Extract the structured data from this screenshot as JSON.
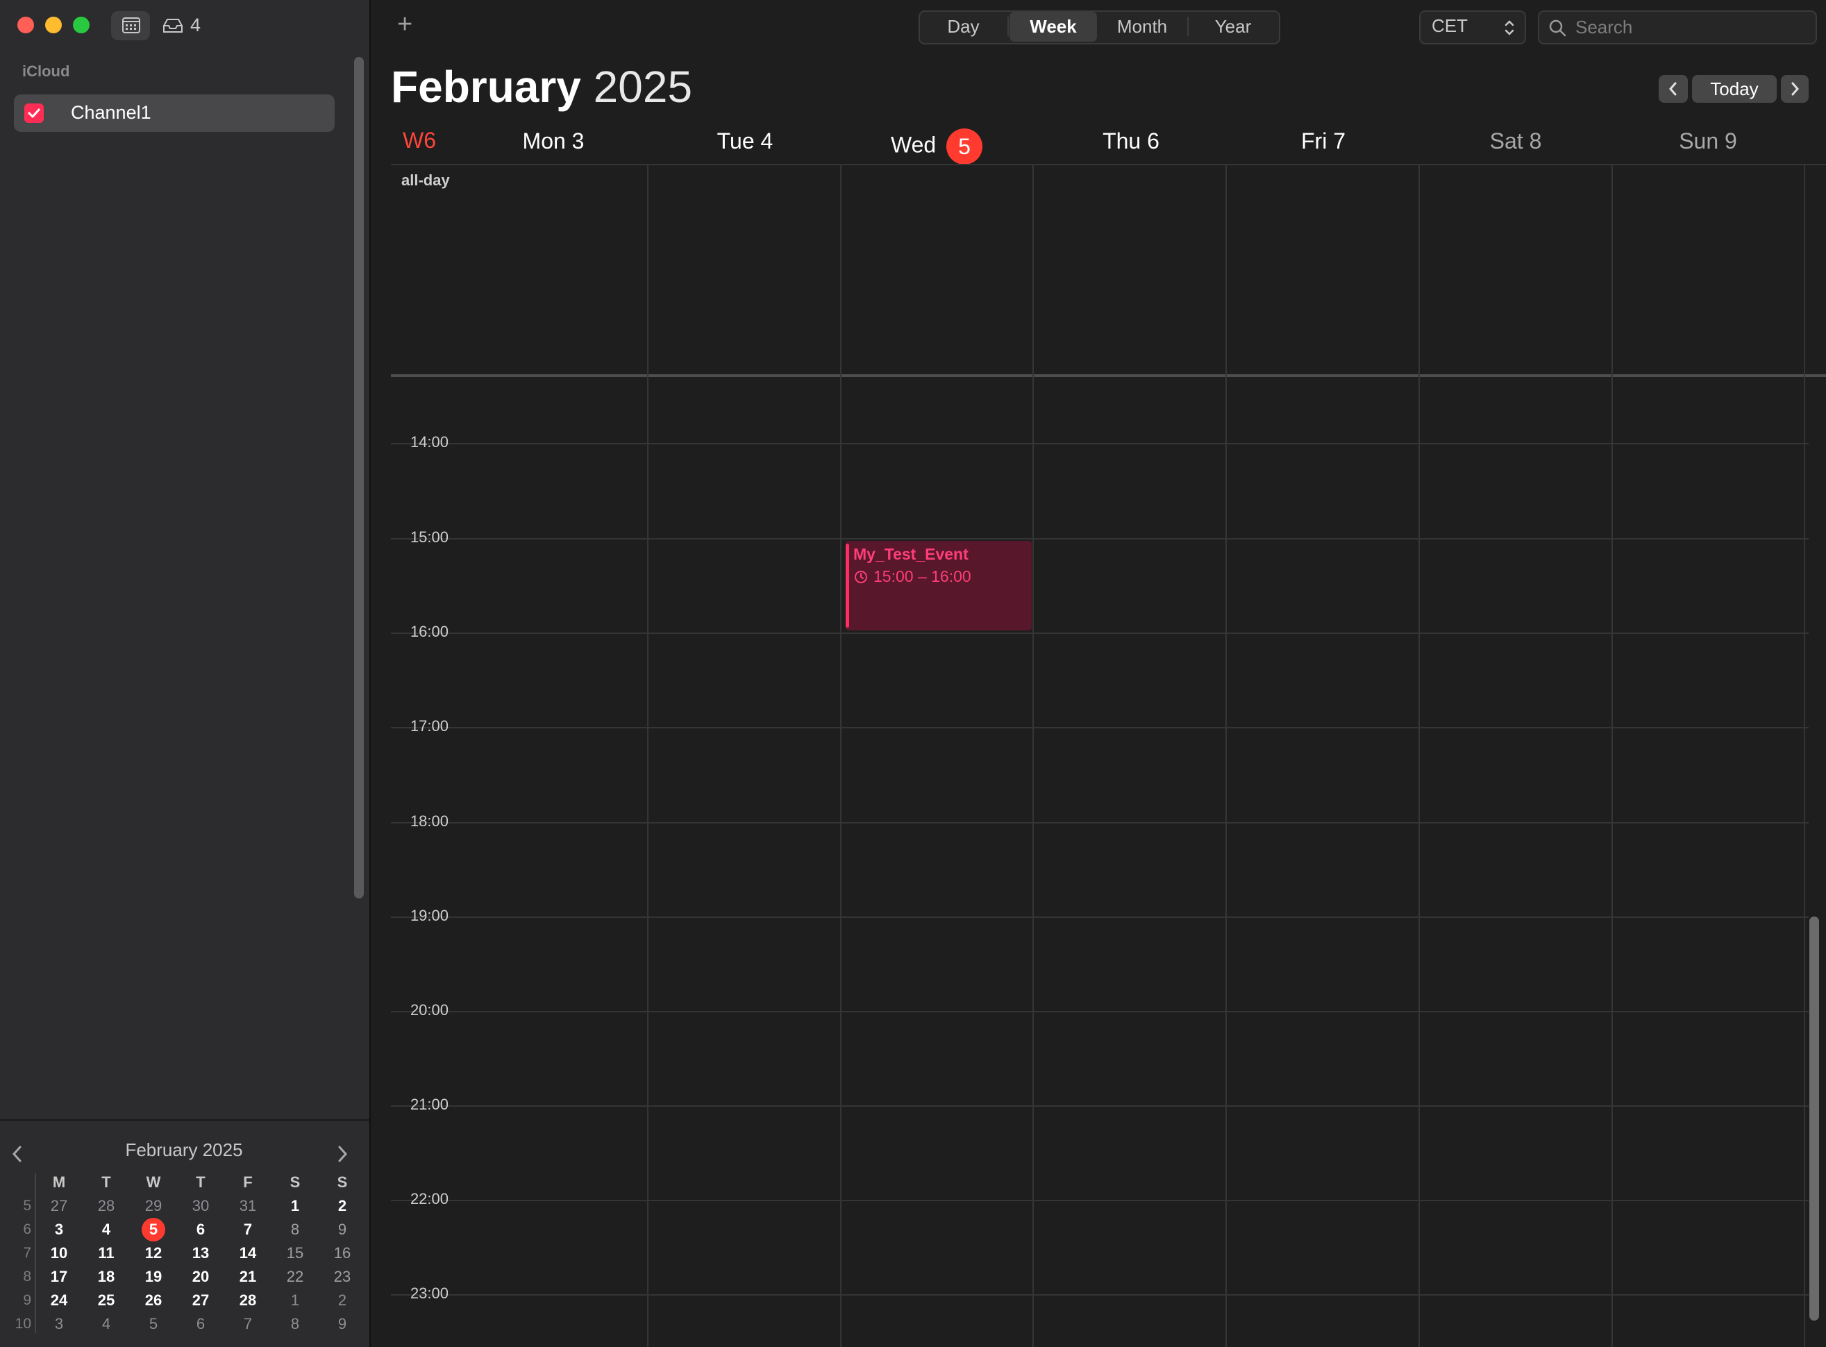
{
  "toolbar": {
    "badge_count": "4",
    "add_label": "+",
    "views": [
      "Day",
      "Week",
      "Month",
      "Year"
    ],
    "active_view": "Week",
    "timezone": "CET",
    "search_placeholder": "Search"
  },
  "sidebar": {
    "section": "iCloud",
    "calendars": [
      {
        "name": "Channel1",
        "checked": true,
        "color": "#ff2d55"
      }
    ]
  },
  "mini_calendar": {
    "title": "February 2025",
    "weekday_headers": [
      "M",
      "T",
      "W",
      "T",
      "F",
      "S",
      "S"
    ],
    "weeks": [
      {
        "week": "5",
        "days": [
          "27",
          "28",
          "29",
          "30",
          "31",
          "1",
          "2"
        ]
      },
      {
        "week": "6",
        "days": [
          "3",
          "4",
          "5",
          "6",
          "7",
          "8",
          "9"
        ]
      },
      {
        "week": "7",
        "days": [
          "10",
          "11",
          "12",
          "13",
          "14",
          "15",
          "16"
        ]
      },
      {
        "week": "8",
        "days": [
          "17",
          "18",
          "19",
          "20",
          "21",
          "22",
          "23"
        ]
      },
      {
        "week": "9",
        "days": [
          "24",
          "25",
          "26",
          "27",
          "28",
          "1",
          "2"
        ]
      },
      {
        "week": "10",
        "days": [
          "3",
          "4",
          "5",
          "6",
          "7",
          "8",
          "9"
        ]
      }
    ],
    "today": "5"
  },
  "main": {
    "month": "February",
    "year": "2025",
    "today_button": "Today",
    "week_label": "W6",
    "days": [
      {
        "name": "Mon",
        "num": "3"
      },
      {
        "name": "Tue",
        "num": "4"
      },
      {
        "name": "Wed",
        "num": "5",
        "today": true
      },
      {
        "name": "Thu",
        "num": "6"
      },
      {
        "name": "Fri",
        "num": "7"
      },
      {
        "name": "Sat",
        "num": "8"
      },
      {
        "name": "Sun",
        "num": "9"
      }
    ],
    "allday_label": "all-day",
    "hours": [
      "14:00",
      "15:00",
      "16:00",
      "17:00",
      "18:00",
      "19:00",
      "20:00",
      "21:00",
      "22:00",
      "23:00"
    ]
  },
  "event": {
    "title": "My_Test_Event",
    "time": "15:00 – 16:00",
    "day": "Wed 5",
    "color": "#ff2d64"
  },
  "colors": {
    "accent_red": "#ff3b30",
    "event_pink": "#ff2d64"
  }
}
